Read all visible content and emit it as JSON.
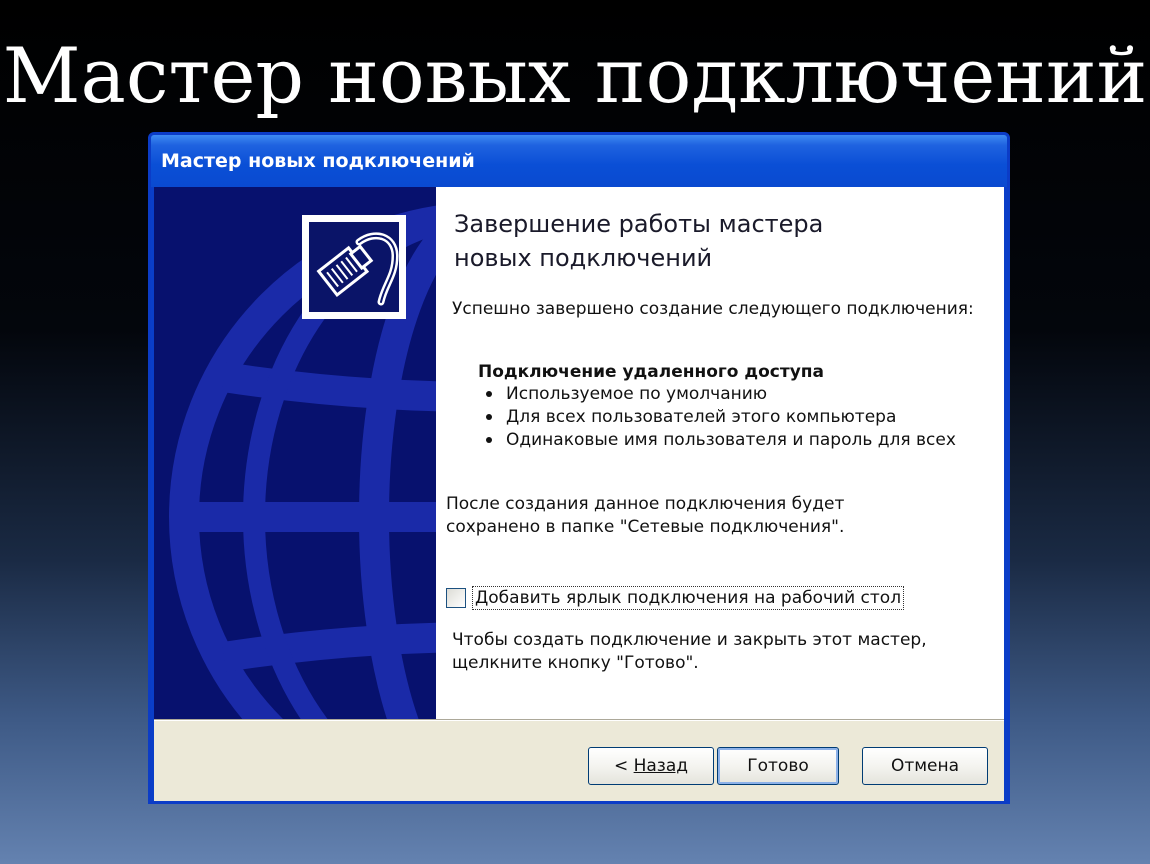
{
  "slide": {
    "title": "Мастер новых подключений"
  },
  "window": {
    "title": "Мастер новых подключений"
  },
  "wizard": {
    "heading_line1": "Завершение работы мастера",
    "heading_line2": "новых подключений",
    "intro": "Успешно завершено создание следующего подключения:",
    "connection_name": "Подключение удаленного доступа",
    "bullets": [
      "Используемое по умолчанию",
      "Для всех пользователей этого компьютера",
      "Одинаковые имя пользователя и пароль для всех"
    ],
    "save_line1": "После создания данное подключения будет",
    "save_line2": "сохранено в папке \"Сетевые подключения\".",
    "shortcut_checkbox": {
      "label": "Добавить ярлык подключения на рабочий стол",
      "checked": false
    },
    "finish_line1": "Чтобы создать подключение и закрыть этот мастер,",
    "finish_line2": "щелкните кнопку \"Готово\"."
  },
  "buttons": {
    "back_prefix": "< ",
    "back_label": "Назад",
    "finish_label": "Готово",
    "cancel_label": "Отмена"
  },
  "icons": {
    "wizard": "network-cable-icon",
    "background": "globe-icon"
  },
  "colors": {
    "titlebar": "#0a4fd6",
    "left_panel": "#07116e",
    "globe_lines": "#1a2aa8",
    "dialog_face": "#ece9d8"
  }
}
